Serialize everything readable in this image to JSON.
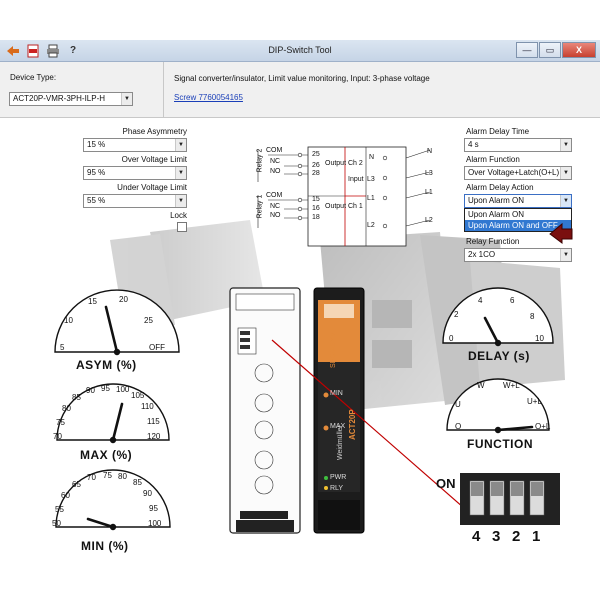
{
  "window": {
    "title": "DIP-Switch Tool",
    "toolbar": [
      "app-icon",
      "pdf-icon",
      "print-icon",
      "help-icon"
    ],
    "help_glyph": "?",
    "controls": {
      "minimize": "—",
      "maximize": "▭",
      "close": "X"
    }
  },
  "device": {
    "type_label": "Device Type:",
    "type_value": "ACT20P-VMR-3PH-ILP-H",
    "description": "Signal converter/insulator, Limit value monitoring, Input: 3-phase voltage",
    "link": "Screw 7760054165"
  },
  "left_panel": {
    "phase_asymmetry": {
      "label": "Phase Asymmetry",
      "value": "15 %"
    },
    "over_voltage": {
      "label": "Over Voltage Limit",
      "value": "95 %"
    },
    "under_voltage": {
      "label": "Under Voltage Limit",
      "value": "55 %"
    },
    "lock": {
      "label": "Lock",
      "checked": false
    }
  },
  "right_panel": {
    "alarm_delay_time": {
      "label": "Alarm Delay Time",
      "value": "4 s"
    },
    "alarm_function": {
      "label": "Alarm Function",
      "value": "Over Voltage+Latch(O+L)"
    },
    "alarm_delay_action": {
      "label": "Alarm Delay Action",
      "value": "Upon Alarm ON",
      "options": [
        "Upon Alarm ON",
        "Upon Alarm ON and OFF"
      ],
      "highlighted": "Upon Alarm ON and OFF"
    },
    "relay_function": {
      "label": "Relay Function",
      "value": "2x 1CO"
    }
  },
  "gauges": {
    "asym": {
      "label": "ASYM (%)",
      "ticks": [
        "5",
        "10",
        "15",
        "20",
        "25",
        "OFF"
      ],
      "value": "15"
    },
    "max": {
      "label": "MAX (%)",
      "ticks": [
        "70",
        "75",
        "80",
        "85",
        "90",
        "95",
        "100",
        "105",
        "110",
        "115",
        "120"
      ],
      "value": "95"
    },
    "min": {
      "label": "MIN (%)",
      "ticks": [
        "50",
        "55",
        "60",
        "65",
        "70",
        "75",
        "80",
        "85",
        "90",
        "95",
        "100"
      ],
      "value": "55"
    },
    "delay": {
      "label": "DELAY (s)",
      "ticks": [
        "0",
        "2",
        "4",
        "6",
        "8",
        "10"
      ],
      "value": "4"
    },
    "function": {
      "label": "FUNCTION",
      "ticks": [
        "O",
        "W",
        "W+L",
        "U+L",
        "U",
        "O+L"
      ],
      "value": "O+L"
    }
  },
  "wiring": {
    "relay1": "Relay 1",
    "relay2": "Relay 2",
    "com": "COM",
    "nc": "NC",
    "no": "NO",
    "pins_left": [
      "25",
      "26",
      "28",
      "15",
      "16",
      "18"
    ],
    "pins_right": [
      "N",
      "L3",
      "L1",
      "L2"
    ],
    "lines_right": [
      "N",
      "L3",
      "L1",
      "L2"
    ],
    "output_ch2": "Output Ch 2",
    "output_ch1": "Output Ch 1",
    "input": "Input"
  },
  "dip": {
    "on_label": "ON",
    "numbers": [
      "4",
      "3",
      "2",
      "1"
    ]
  },
  "device_front": {
    "brand": "Weidmüller",
    "model": "ACT20P",
    "labels": [
      "SEQ/ASYM",
      "MIN",
      "MAX",
      "PWR",
      "RLY"
    ]
  },
  "colors": {
    "accent": "#3178d1",
    "link": "#1a3fb8",
    "device_orange": "#e38a3a",
    "wire_red": "#c00000"
  }
}
